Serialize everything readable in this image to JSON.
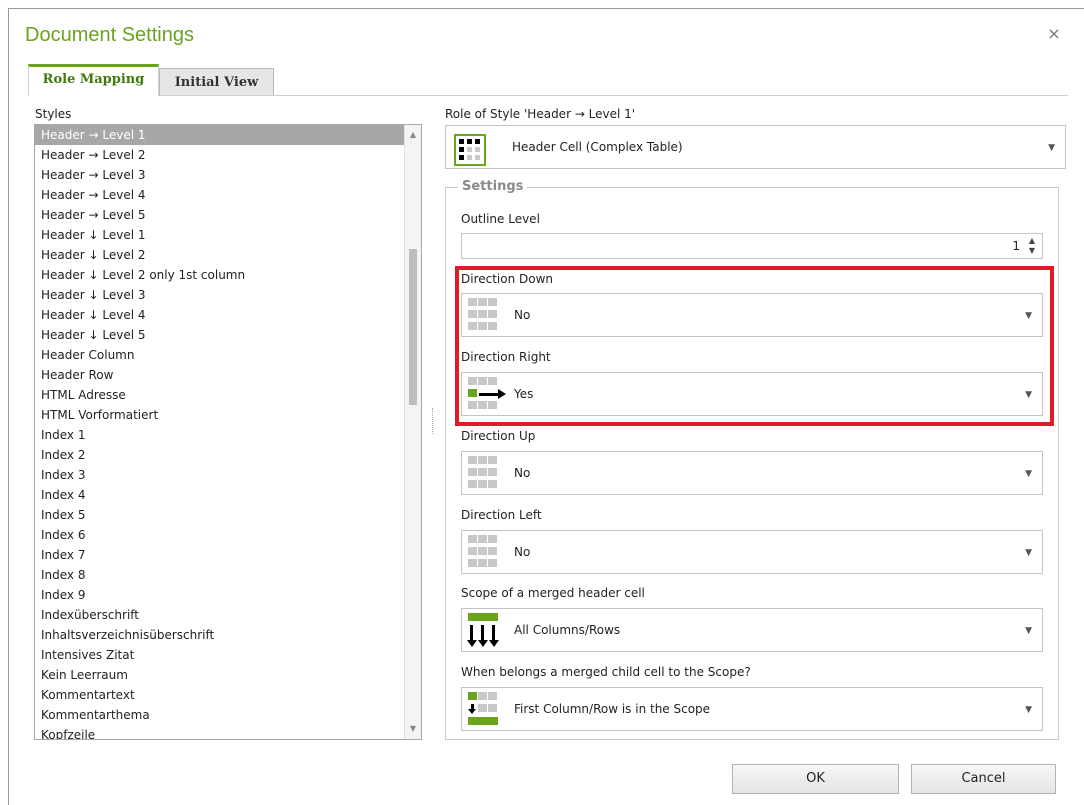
{
  "dialog": {
    "title": "Document Settings",
    "close_glyph": "×"
  },
  "tabs": [
    {
      "label": "Role Mapping"
    },
    {
      "label": "Initial View"
    }
  ],
  "styles": {
    "label": "Styles",
    "items": [
      "Header → Level 1",
      "Header → Level 2",
      "Header → Level 3",
      "Header → Level 4",
      "Header → Level 5",
      "Header ↓ Level 1",
      "Header ↓ Level 2",
      "Header ↓ Level 2 only 1st column",
      "Header ↓ Level 3",
      "Header ↓ Level 4",
      "Header ↓ Level 5",
      "Header Column",
      "Header Row",
      "HTML Adresse",
      "HTML Vorformatiert",
      "Index 1",
      "Index 2",
      "Index 3",
      "Index 4",
      "Index 5",
      "Index 6",
      "Index 7",
      "Index 8",
      "Index 9",
      "Indexüberschrift",
      "Inhaltsverzeichnisüberschrift",
      "Intensives Zitat",
      "Kein Leerraum",
      "Kommentartext",
      "Kommentarthema",
      "Kopfzeile"
    ],
    "selected": "Header → Level 1"
  },
  "role": {
    "label": "Role of Style 'Header → Level 1'",
    "value": "Header Cell (Complex Table)"
  },
  "settings": {
    "legend": "Settings",
    "outline_level": {
      "label": "Outline Level",
      "value": "1"
    },
    "direction_down": {
      "label": "Direction Down",
      "value": "No"
    },
    "direction_right": {
      "label": "Direction Right",
      "value": "Yes"
    },
    "direction_up": {
      "label": "Direction Up",
      "value": "No"
    },
    "direction_left": {
      "label": "Direction Left",
      "value": "No"
    },
    "scope": {
      "label": "Scope of a merged header cell",
      "value": "All Columns/Rows"
    },
    "child_scope": {
      "label": "When belongs a merged child cell to the Scope?",
      "value": "First Column/Row is in the Scope"
    }
  },
  "buttons": {
    "ok": "OK",
    "cancel": "Cancel"
  },
  "colors": {
    "accent": "#6aa31e",
    "highlight": "#e21b2a",
    "selection": "#a7a7a7"
  }
}
